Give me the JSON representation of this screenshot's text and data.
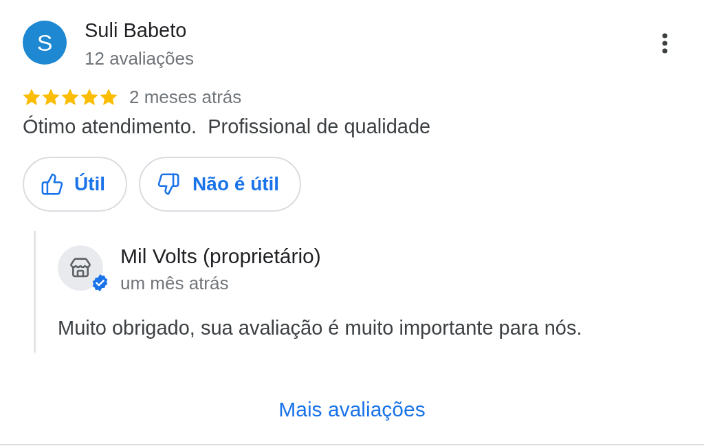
{
  "review": {
    "author": {
      "avatar_initial": "S",
      "name": "Suli Babeto",
      "review_count": "12 avaliações"
    },
    "stars": 5,
    "time": "2 meses atrás",
    "text": "Ótimo atendimento.  Profissional de qualidade",
    "buttons": [
      {
        "kind": "helpful",
        "label": "Útil"
      },
      {
        "kind": "not_helpful",
        "label": "Não é útil"
      }
    ]
  },
  "owner_reply": {
    "name": "Mil Volts (proprietário)",
    "verified": true,
    "time": "um mês atrás",
    "text": "Muito obrigado, sua avaliação é muito importante para nós."
  },
  "more_reviews_link": "Mais avaliações"
}
